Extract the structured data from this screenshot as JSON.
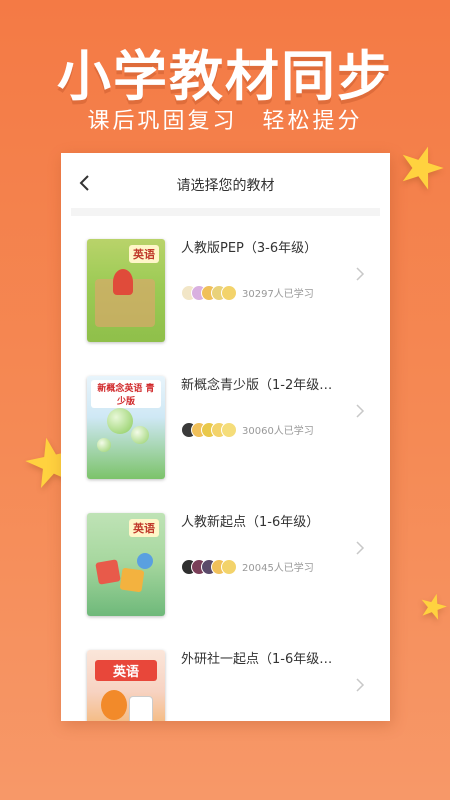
{
  "headline": "小学教材同步",
  "subheadline": "课后巩固复习　轻松提分",
  "card": {
    "title": "请选择您的教材"
  },
  "books": [
    {
      "name": "人教版PEP（3-6年级）",
      "cover_text": "英语",
      "learners": "30297人已学习",
      "cover_colors": [
        "#b9d36a",
        "#8fbf4a"
      ],
      "avatar_colors": [
        "#f2e6c7",
        "#d9b0e0",
        "#f0c05a",
        "#e9d27a",
        "#f3d36b"
      ]
    },
    {
      "name": "新概念青少版（1-2年级…",
      "cover_text": "新概念英语 青少版",
      "learners": "30060人已学习",
      "cover_colors": [
        "#cfe8f5",
        "#7cc36a"
      ],
      "avatar_colors": [
        "#3a3a3a",
        "#f0c05a",
        "#e9c84a",
        "#f3d36b",
        "#f5dd7a"
      ]
    },
    {
      "name": "人教新起点（1-6年级）",
      "cover_text": "英语",
      "learners": "20045人已学习",
      "cover_colors": [
        "#a8d8a0",
        "#6fb97a"
      ],
      "avatar_colors": [
        "#2f2f2f",
        "#7a3e58",
        "#5a4a6a",
        "#f0c05a",
        "#f3d36b"
      ]
    },
    {
      "name": "外研社一起点（1-6年级…",
      "cover_text": "英语",
      "learners": "",
      "cover_colors": [
        "#f7d3c2",
        "#f2a548"
      ],
      "avatar_colors": []
    }
  ],
  "icons": {
    "back": "chevron-left-icon",
    "more": "chevron-right-icon",
    "decor": "star-icon"
  },
  "colors": {
    "background": "#f47a45",
    "star": "#ffd23f",
    "accent_text": "#333333"
  }
}
